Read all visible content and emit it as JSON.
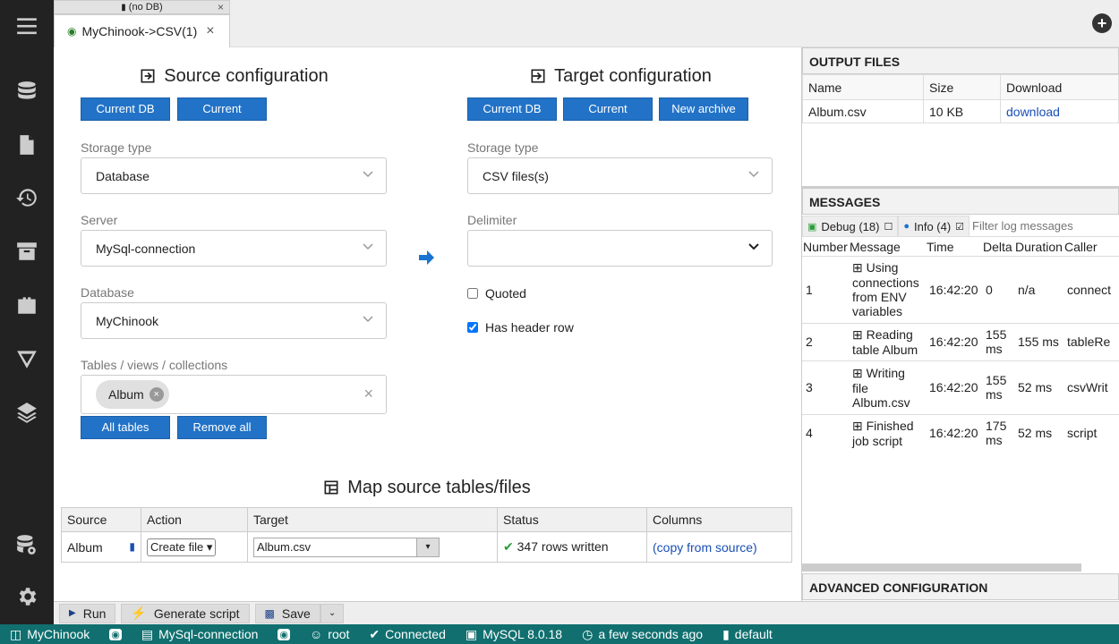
{
  "tabs": {
    "small_tab_label": "(no DB)",
    "main_tab_label": "MyChinook->CSV(1)"
  },
  "source": {
    "heading": "Source configuration",
    "btn_current_db": "Current DB",
    "btn_current_archive": "Current archive",
    "storage_label": "Storage type",
    "storage_value": "Database",
    "server_label": "Server",
    "server_value": "MySql-connection",
    "database_label": "Database",
    "database_value": "MyChinook",
    "tables_label": "Tables / views / collections",
    "table_chip": "Album",
    "btn_all_tables": "All tables",
    "btn_remove_all": "Remove all"
  },
  "target": {
    "heading": "Target configuration",
    "btn_current_db": "Current DB",
    "btn_current_archive": "Current archive",
    "btn_new_archive": "New archive",
    "storage_label": "Storage type",
    "storage_value": "CSV files(s)",
    "delimiter_label": "Delimiter",
    "delimiter_value": "",
    "quoted_label": "Quoted",
    "quoted_checked": false,
    "header_row_label": "Has header row",
    "header_row_checked": true
  },
  "map": {
    "heading": "Map source tables/files",
    "headers": [
      "Source",
      "Action",
      "Target",
      "Status",
      "Columns"
    ],
    "rows": [
      {
        "source": "Album",
        "action": "Create file",
        "target": "Album.csv",
        "status": "347 rows written",
        "columns": "(copy from source)"
      }
    ]
  },
  "output_files": {
    "title": "OUTPUT FILES",
    "headers": [
      "Name",
      "Size",
      "Download"
    ],
    "rows": [
      {
        "name": "Album.csv",
        "size": "10 KB",
        "download": "download"
      }
    ]
  },
  "messages": {
    "title": "MESSAGES",
    "debug_label": "Debug (18)",
    "info_label": "Info (4)",
    "filter_placeholder": "Filter log messages",
    "headers": [
      "Number",
      "Message",
      "Time",
      "Delta",
      "Duration",
      "Caller"
    ],
    "rows": [
      {
        "number": "1",
        "message": "Using connections from ENV variables",
        "time": "16:42:20",
        "delta": "0",
        "duration": "n/a",
        "caller": "connect"
      },
      {
        "number": "2",
        "message": "Reading table Album",
        "time": "16:42:20",
        "delta": "155 ms",
        "duration": "155 ms",
        "caller": "tableRe"
      },
      {
        "number": "3",
        "message": "Writing file Album.csv",
        "time": "16:42:20",
        "delta": "155 ms",
        "duration": "52 ms",
        "caller": "csvWrit"
      },
      {
        "number": "4",
        "message": "Finished job script",
        "time": "16:42:20",
        "delta": "175 ms",
        "duration": "52 ms",
        "caller": "script"
      }
    ]
  },
  "advanced": {
    "title": "ADVANCED CONFIGURATION"
  },
  "toolbar": {
    "run_label": "Run",
    "generate_label": "Generate script",
    "save_label": "Save"
  },
  "statusbar": {
    "db": "MyChinook",
    "connection": "MySql-connection",
    "user": "root",
    "state": "Connected",
    "version": "MySQL 8.0.18",
    "time": "a few seconds ago",
    "schema": "default"
  },
  "colors": {
    "accent": "#2273c7",
    "statusbar": "#116f6f",
    "sidebar": "#222222",
    "success": "#2a9d3a"
  },
  "icons": [
    "menu-icon",
    "database-icon",
    "file-icon",
    "history-icon",
    "archive-icon",
    "plugin-icon",
    "filter-icon",
    "layers-icon",
    "database-view-icon",
    "gear-icon"
  ]
}
